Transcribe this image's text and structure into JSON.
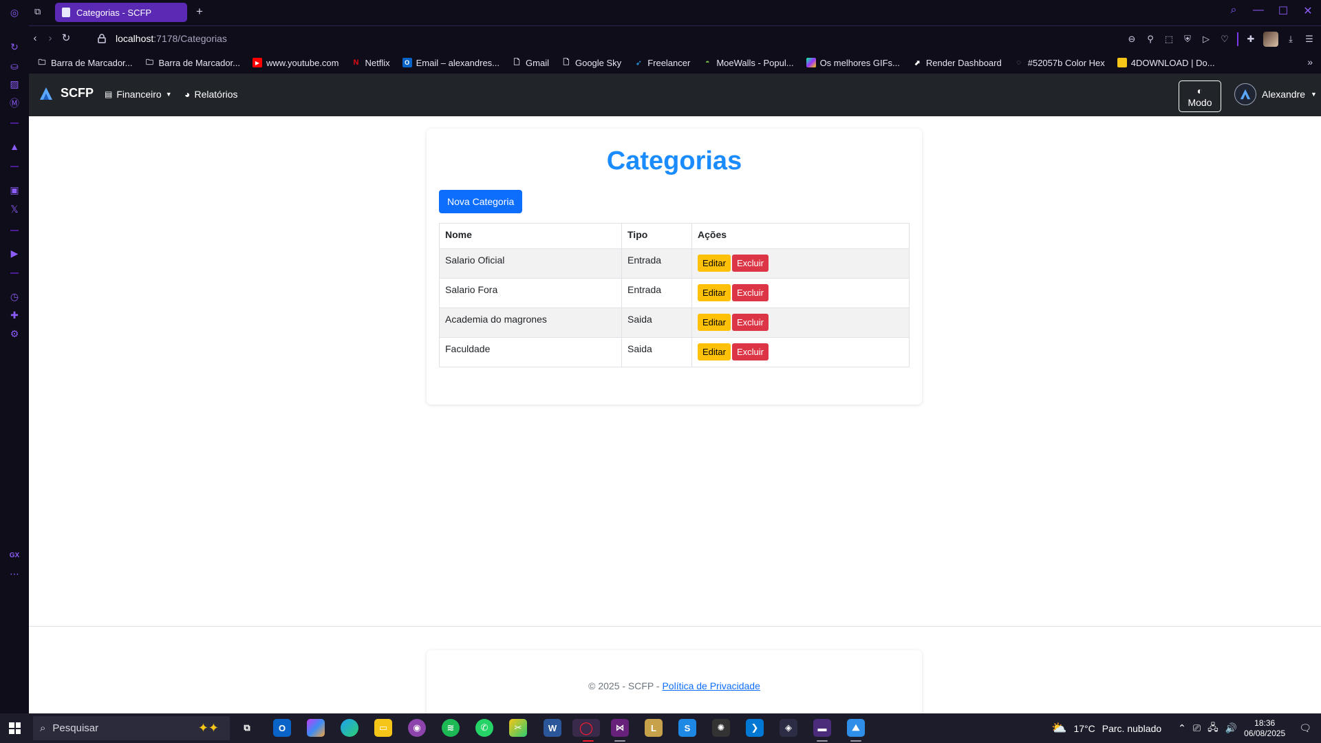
{
  "browser": {
    "tab_title": "Categorias - SCFP",
    "new_tab": "+",
    "url_host": "localhost",
    "url_path": ":7178/Categorias",
    "bookmarks": [
      {
        "label": "Barra de Marcador...",
        "icon": "folder-icon",
        "color": "#e6e6f2"
      },
      {
        "label": "Barra de Marcador...",
        "icon": "folder-icon",
        "color": "#e6e6f2"
      },
      {
        "label": "www.youtube.com",
        "icon": "youtube-icon",
        "color": "#ff0000"
      },
      {
        "label": "Netflix",
        "icon": "netflix-icon",
        "color": "#e50914"
      },
      {
        "label": "Email – alexandres...",
        "icon": "outlook-icon",
        "color": "#0a64c8"
      },
      {
        "label": "Gmail",
        "icon": "page-icon",
        "color": "#e6e6f2"
      },
      {
        "label": "Google Sky",
        "icon": "page-icon",
        "color": "#e6e6f2"
      },
      {
        "label": "Freelancer",
        "icon": "freelancer-icon",
        "color": "#29b2fe"
      },
      {
        "label": "MoeWalls - Popul...",
        "icon": "moewalls-icon",
        "color": "#7ab648"
      },
      {
        "label": "Os melhores GIFs...",
        "icon": "giphy-icon",
        "color": "#a855f7"
      },
      {
        "label": "Render Dashboard",
        "icon": "render-icon",
        "color": "#ffffff"
      },
      {
        "label": "#52057b Color Hex",
        "icon": "colorhex-icon",
        "color": "#888888"
      },
      {
        "label": "4DOWNLOAD | Do...",
        "icon": "folder-yellow-icon",
        "color": "#f5c518"
      }
    ]
  },
  "navbar": {
    "brand": "SCFP",
    "financeiro": "Financeiro",
    "relatorios": "Relatórios",
    "mode_label": "Modo",
    "user_name": "Alexandre"
  },
  "page": {
    "title": "Categorias",
    "new_button": "Nova Categoria",
    "columns": [
      "Nome",
      "Tipo",
      "Ações"
    ],
    "rows": [
      {
        "nome": "Salario Oficial",
        "tipo": "Entrada"
      },
      {
        "nome": "Salario Fora",
        "tipo": "Entrada"
      },
      {
        "nome": "Academia do magrones",
        "tipo": "Saida"
      },
      {
        "nome": "Faculdade",
        "tipo": "Saida"
      }
    ],
    "edit_label": "Editar",
    "delete_label": "Excluir"
  },
  "footer": {
    "copyright": "© 2025 - SCFP - ",
    "privacy": "Política de Privacidade"
  },
  "taskbar": {
    "search_placeholder": "Pesquisar",
    "weather": "17°C",
    "weather_desc": "Parc. nublado",
    "time": "18:36",
    "date": "06/08/2025"
  },
  "colors": {
    "accent": "#1a8cff",
    "primary_button": "#0d6efd",
    "edit_button": "#ffc107",
    "delete_button": "#dc3545",
    "navbar_bg": "#212529",
    "browser_accent": "#8b5cf6"
  }
}
